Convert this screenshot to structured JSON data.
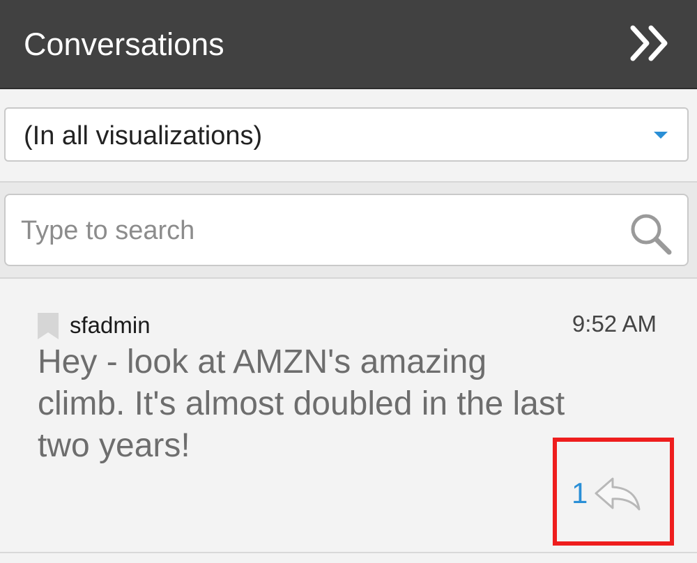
{
  "header": {
    "title": "Conversations",
    "collapse_icon": "double-chevron-right-icon"
  },
  "filter": {
    "selected": "(In all visualizations)",
    "caret_color": "#2a8fd6"
  },
  "search": {
    "placeholder": "Type to search",
    "icon": "search-icon"
  },
  "conversation": {
    "author": "sfadmin",
    "time": "9:52 AM",
    "message": "Hey - look at AMZN's amazing climb. It's almost doubled in the last two years!",
    "reply_count": "1",
    "reply_icon": "reply-arrow-icon",
    "bookmark_icon": "bookmark-icon"
  },
  "colors": {
    "header_bg": "#414141",
    "accent": "#2a8fd6",
    "highlight": "#ee1d1d"
  }
}
